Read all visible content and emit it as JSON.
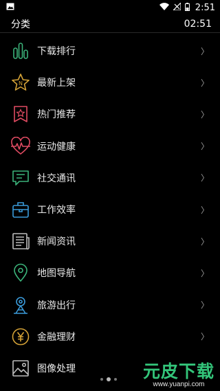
{
  "status_bar": {
    "time": "2:51",
    "icons": [
      "image-icon",
      "wifi-icon",
      "signal-icon",
      "battery-icon"
    ]
  },
  "header": {
    "title": "分类",
    "clock": "02:51"
  },
  "categories": [
    {
      "label": "下载排行",
      "icon": "bar-chart-icon",
      "color": "#3bb37a"
    },
    {
      "label": "最新上架",
      "icon": "star-new-icon",
      "color": "#d4a237"
    },
    {
      "label": "热门推荐",
      "icon": "bookmark-star-icon",
      "color": "#e04b62"
    },
    {
      "label": "运动健康",
      "icon": "heart-pulse-icon",
      "color": "#e04b62"
    },
    {
      "label": "社交通讯",
      "icon": "chat-icon",
      "color": "#3bb37a"
    },
    {
      "label": "工作效率",
      "icon": "briefcase-icon",
      "color": "#3a9ad9"
    },
    {
      "label": "新闻资讯",
      "icon": "newspaper-icon",
      "color": "#bdbdbd"
    },
    {
      "label": "地图导航",
      "icon": "map-pin-icon",
      "color": "#3bb37a"
    },
    {
      "label": "旅游出行",
      "icon": "tower-icon",
      "color": "#3a9ad9"
    },
    {
      "label": "金融理财",
      "icon": "yen-coin-icon",
      "color": "#d4a237"
    },
    {
      "label": "图像处理",
      "icon": "image-icon",
      "color": "#bdbdbd"
    }
  ],
  "chevron": "〉",
  "watermark": {
    "main": "元皮下载",
    "url": "www.yuanpi.com"
  }
}
